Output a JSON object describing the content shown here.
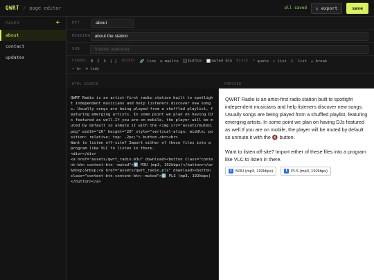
{
  "app": {
    "brand": "QWRT",
    "separator": "/",
    "section": "page editor",
    "status": "all saved",
    "export_label": "↓ export",
    "save_label": "save"
  },
  "sidebar": {
    "heading": "PAGES",
    "add_label": "+",
    "pages": [
      {
        "label": "about",
        "active": true
      },
      {
        "label": "contact",
        "active": false
      },
      {
        "label": "updates",
        "active": false
      }
    ]
  },
  "fields": {
    "key": {
      "label": "KEY",
      "value": "about"
    },
    "heading": {
      "label": "HEADING",
      "value": "about the station"
    },
    "sub": {
      "label": "SUB",
      "placeholder": "Subtitle (optional)"
    }
  },
  "toolbar": {
    "format_label": "FORMAT",
    "format_tools": [
      "B",
      "I",
      "S",
      "{ }"
    ],
    "insert_label": "INSERT",
    "insert_tools": [
      "🔗 link",
      "✉ mailto",
      "button",
      "muted btn"
    ],
    "block_label": "BLOCK",
    "block_tools": [
      "\" quote",
      "• list",
      "1. list",
      "↵ break"
    ],
    "row2_tools": [
      "— hr",
      "⌫ tidy"
    ]
  },
  "panes": {
    "source_label": "HTML SOURCE",
    "preview_label": "PREVIEW",
    "source_text": "QWRT Radio is an artist-first radio station built to spotlight independent musicians and help listeners discover new songs. Usually songs are being played from a shuffled playlist, featuring emerging artists. In some point we plan on having DJs featured as well.If you are on mobile, the player will be muted by default so unmute it with the <img src=\"assets/muted.png\" width=\"20\" height=\"20\" style=\"vertical-align: middle; position: relative; top: -2px;\"> button.<br><br>\nWant to listen off-site? Import either of these files into a program like VLC to listen in there.\n<div></div>\n<a href=\"assets/qwrt_radio.m3u\" download><button class=\"content-btn content-btn--muted\">⬇️ M3U (mp3, 192kbps)</button></a>&nbsp;&nbsp;<a href=\"assets/qwrt_radio.pls\" download><button class=\"content-btn content-btn--muted\">⬇️ PLS (mp3, 192kbps)</button></a>",
    "preview_para1_before": "QWRT Radio is an artist-first radio station built to spotlight independent musicians and help listeners discover new songs. Usually songs are being played from a shuffled playlist, featuring emerging artists. In some point we plan on having DJs featured as well.If you are on mobile, the player will be muted by default so unmute it with the",
    "preview_mute_glyph": "🔇",
    "preview_para1_after": "button.",
    "preview_para2": "Want to listen off-site? Import either of these files into a program like VLC to listen in there.",
    "preview_buttons": [
      "M3U (mp3, 192kbps)",
      "PLS (mp3, 192kbps)"
    ]
  },
  "colors": {
    "accent": "#d8f062",
    "saved": "#9fd36a",
    "download_icon": "#2f6fd6"
  }
}
